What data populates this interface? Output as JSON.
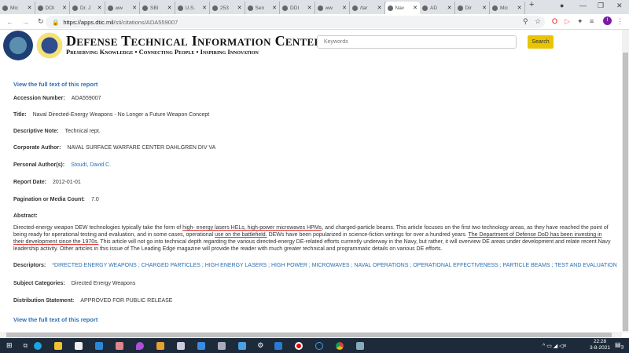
{
  "tabs": [
    "Mic",
    "DOI",
    "Dr. J",
    "ww",
    "SBI",
    "U.S.",
    "253",
    "Sen",
    "DDI",
    "ww",
    "/tar",
    "Nav",
    "AD",
    "Dir",
    "Mic"
  ],
  "active_tab": 11,
  "address": {
    "host": "https://apps.dtic.mil",
    "path": "/sti/citations/ADA559007"
  },
  "header": {
    "title": "Defense Technical Information Center",
    "tagline": "Preserving Knowledge • Connecting People • Inspiring Innovation",
    "search_placeholder": "Keywords",
    "search_label": "Search"
  },
  "record": {
    "view_link": "View the full text of this report",
    "fields": [
      {
        "label": "Accession Number:",
        "value": "ADA559007"
      },
      {
        "label": "Title:",
        "value": "Naval Directed-Energy Weapons - No Longer a Future Weapon Concept"
      },
      {
        "label": "Descriptive Note:",
        "value": "Technical rept."
      },
      {
        "label": "Corporate Author:",
        "value": "NAVAL SURFACE WARFARE CENTER DAHLGREN DIV VA"
      },
      {
        "label": "Personal Author(s):",
        "value": "Stoudt, David C.",
        "link": true
      },
      {
        "label": "Report Date:",
        "value": "2012-01-01"
      },
      {
        "label": "Pagination or Media Count:",
        "value": "7.0"
      }
    ],
    "abstract_label": "Abstract:",
    "abstract": "Directed-energy weapon DEW technologies typically take the form of high- energy lasers HELs, high-power microwaves HPMs, and charged-particle beams. This article focuses on the first two technology areas, as they have reached the point of being ready for operational testing and evaluation, and in some cases, operational use on the battlefield. DEWs have been popularized in science-fiction writings for over a hundred years. The Department of Defense DoD has been investing in their development since the 1970s. This article will not go into technical depth regarding the various directed-energy DE-related efforts currently underway in the Navy, but rather, it will overview DE areas under development and relate recent Navy leadership activity. Other articles in this issue of The Leading Edge magazine will provide the reader with much greater technical and programmatic details on various DE efforts.",
    "descriptors_label": "Descriptors:",
    "descriptors": "*DIRECTED ENERGY WEAPONS ; CHARGED PARTICLES ; HIGH ENERGY LASERS ; HIGH POWER ; MICROWAVES ; NAVAL OPERATIONS ; OPERATIONAL EFFECTIVENESS ; PARTICLE BEAMS ; TEST AND EVALUATION",
    "subject_label": "Subject Categories:",
    "subject": "Directed Energy Weapons",
    "distribution_label": "Distribution Statement:",
    "distribution": "APPROVED FOR PUBLIC RELEASE"
  },
  "taskbar": {
    "time": "22:28",
    "date": "3-8-2021",
    "notifications": "3"
  },
  "colors": {
    "link": "#2a6fb5",
    "search": "#e8c500",
    "taskbar": "#1c2a3a"
  }
}
